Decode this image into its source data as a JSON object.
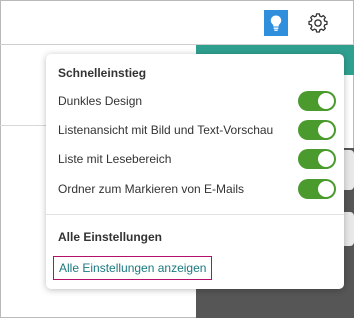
{
  "header": {
    "tips_button_icon": "lightbulb-icon",
    "settings_button_icon": "gear-icon"
  },
  "quick_settings": {
    "title": "Schnelleinstieg",
    "toggles": [
      {
        "label": "Dunkles Design",
        "on": true
      },
      {
        "label": "Listenansicht mit Bild und Text-Vorschau",
        "on": true
      },
      {
        "label": "Liste mit Lesebereich",
        "on": true
      },
      {
        "label": "Ordner zum Markieren von E-Mails",
        "on": true
      }
    ]
  },
  "all_settings": {
    "title": "Alle Einstellungen",
    "link_label": "Alle Einstellungen anzeigen"
  },
  "colors": {
    "toggle_on": "#4a9a2e",
    "link": "#1a7a7f",
    "focus_outline": "#b3106a",
    "tips_button": "#2f8fdd",
    "accent_strip": "#2fa090"
  }
}
